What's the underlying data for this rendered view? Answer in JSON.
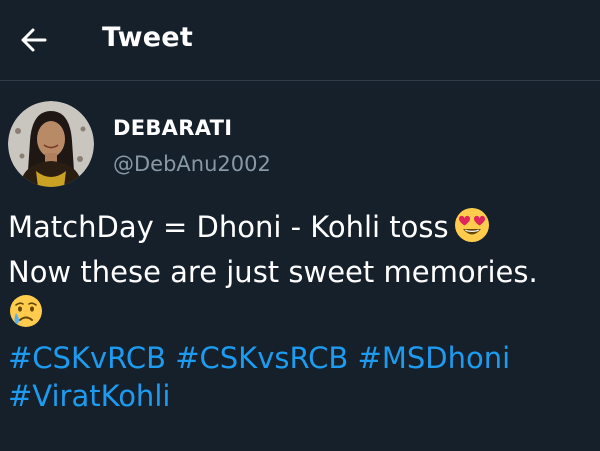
{
  "header": {
    "back_icon": "arrow-left-icon",
    "title": "Tweet"
  },
  "author": {
    "display_name": "DEBARATI",
    "handle": "@DebAnu2002",
    "avatar_icon": "profile-photo"
  },
  "tweet": {
    "line1": "MatchDay = Dhoni - Kohli toss",
    "line1_emoji": "heart-eyes-emoji",
    "line2": "Now these are just sweet memories.",
    "line3_emoji": "crying-face-emoji",
    "hashtags": [
      "#CSKvRCB",
      "#CSKvsRCB",
      "#MSDhoni",
      "#ViratKohli"
    ]
  },
  "colors": {
    "background": "#15202b",
    "text": "#ffffff",
    "secondary_text": "#8899a6",
    "link": "#1d9bf0",
    "divider": "#2f3b47"
  }
}
